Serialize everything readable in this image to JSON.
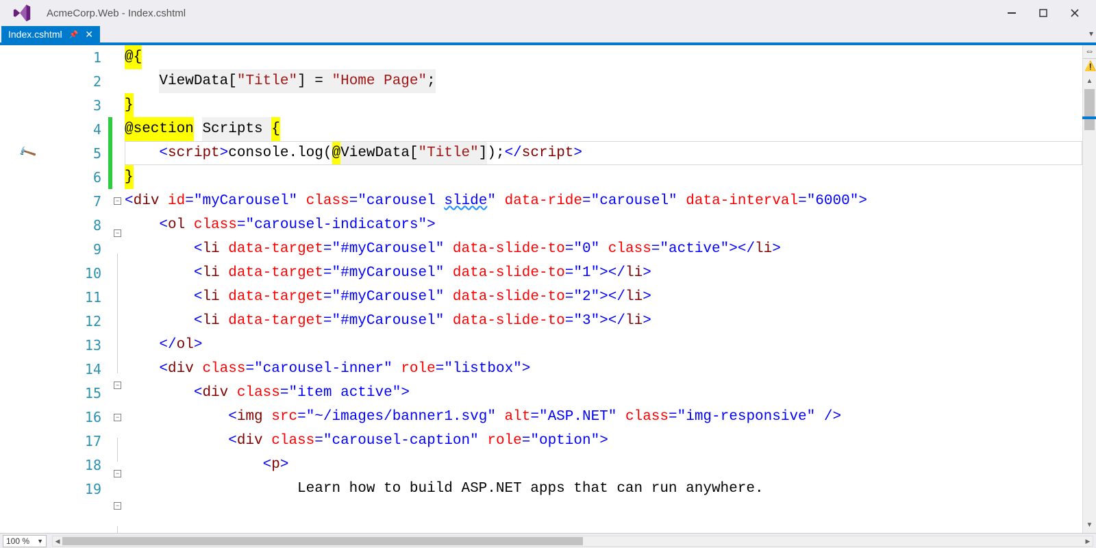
{
  "window": {
    "title": "AcmeCorp.Web - Index.cshtml"
  },
  "tab": {
    "filename": "Index.cshtml"
  },
  "zoom": "100 %",
  "code": {
    "lines": [
      {
        "n": 1,
        "tokens": [
          {
            "t": "@{",
            "c": "t-razor"
          }
        ]
      },
      {
        "n": 2,
        "tokens": [
          {
            "t": "    ",
            "c": ""
          },
          {
            "t": "ViewData[",
            "c": "t-plain t-razor-bg"
          },
          {
            "t": "\"Title\"",
            "c": "t-str t-razor-bg"
          },
          {
            "t": "] = ",
            "c": "t-plain t-razor-bg"
          },
          {
            "t": "\"Home Page\"",
            "c": "t-str t-razor-bg"
          },
          {
            "t": ";",
            "c": "t-plain t-razor-bg"
          }
        ]
      },
      {
        "n": 3,
        "tokens": [
          {
            "t": "}",
            "c": "t-razor"
          }
        ]
      },
      {
        "n": 4,
        "changed": true,
        "tokens": [
          {
            "t": "@section",
            "c": "t-razor"
          },
          {
            "t": " ",
            "c": ""
          },
          {
            "t": "Scripts ",
            "c": "t-plain t-razor-bg"
          },
          {
            "t": "{",
            "c": "t-razor"
          }
        ]
      },
      {
        "n": 5,
        "changed": true,
        "current": true,
        "glyph": "hammer",
        "tokens": [
          {
            "t": "    ",
            "c": ""
          },
          {
            "t": "<",
            "c": "t-punct"
          },
          {
            "t": "script",
            "c": "t-tag"
          },
          {
            "t": ">",
            "c": "t-punct"
          },
          {
            "t": "console.log(",
            "c": "t-plain"
          },
          {
            "t": "@",
            "c": "t-razor"
          },
          {
            "t": "ViewData[",
            "c": "t-plain t-razor-bg"
          },
          {
            "t": "\"Title\"",
            "c": "t-str t-razor-bg"
          },
          {
            "t": "]",
            "c": "t-plain t-razor-bg"
          },
          {
            "t": ");",
            "c": "t-plain"
          },
          {
            "t": "</",
            "c": "t-punct"
          },
          {
            "t": "script",
            "c": "t-tag"
          },
          {
            "t": ">",
            "c": "t-punct"
          }
        ]
      },
      {
        "n": 6,
        "changed": true,
        "tokens": [
          {
            "t": "}",
            "c": "t-razor"
          }
        ]
      },
      {
        "n": 7,
        "fold": "-",
        "tokens": [
          {
            "t": "<",
            "c": "t-punct"
          },
          {
            "t": "div ",
            "c": "t-tag"
          },
          {
            "t": "id",
            "c": "t-attr"
          },
          {
            "t": "=",
            "c": "t-punct"
          },
          {
            "t": "\"myCarousel\"",
            "c": "t-val"
          },
          {
            "t": " ",
            "c": ""
          },
          {
            "t": "class",
            "c": "t-attr"
          },
          {
            "t": "=",
            "c": "t-punct"
          },
          {
            "t": "\"carousel ",
            "c": "t-val"
          },
          {
            "t": "slide",
            "c": "t-val squiggle"
          },
          {
            "t": "\"",
            "c": "t-val"
          },
          {
            "t": " ",
            "c": ""
          },
          {
            "t": "data-ride",
            "c": "t-attr"
          },
          {
            "t": "=",
            "c": "t-punct"
          },
          {
            "t": "\"carousel\"",
            "c": "t-val"
          },
          {
            "t": " ",
            "c": ""
          },
          {
            "t": "data-interval",
            "c": "t-attr"
          },
          {
            "t": "=",
            "c": "t-punct"
          },
          {
            "t": "\"6000\"",
            "c": "t-val"
          },
          {
            "t": ">",
            "c": "t-punct"
          }
        ]
      },
      {
        "n": 8,
        "fold": "-",
        "tick": true,
        "tokens": [
          {
            "t": "    ",
            "c": ""
          },
          {
            "t": "<",
            "c": "t-punct"
          },
          {
            "t": "ol ",
            "c": "t-tag"
          },
          {
            "t": "class",
            "c": "t-attr"
          },
          {
            "t": "=",
            "c": "t-punct"
          },
          {
            "t": "\"carousel-indicators\"",
            "c": "t-val"
          },
          {
            "t": ">",
            "c": "t-punct"
          }
        ]
      },
      {
        "n": 9,
        "tick": true,
        "tokens": [
          {
            "t": "        ",
            "c": ""
          },
          {
            "t": "<",
            "c": "t-punct"
          },
          {
            "t": "li ",
            "c": "t-tag"
          },
          {
            "t": "data-target",
            "c": "t-attr"
          },
          {
            "t": "=",
            "c": "t-punct"
          },
          {
            "t": "\"#myCarousel\"",
            "c": "t-val"
          },
          {
            "t": " ",
            "c": ""
          },
          {
            "t": "data-slide-to",
            "c": "t-attr"
          },
          {
            "t": "=",
            "c": "t-punct"
          },
          {
            "t": "\"0\"",
            "c": "t-val"
          },
          {
            "t": " ",
            "c": ""
          },
          {
            "t": "class",
            "c": "t-attr"
          },
          {
            "t": "=",
            "c": "t-punct"
          },
          {
            "t": "\"active\"",
            "c": "t-val"
          },
          {
            "t": "></",
            "c": "t-punct"
          },
          {
            "t": "li",
            "c": "t-tag"
          },
          {
            "t": ">",
            "c": "t-punct"
          }
        ]
      },
      {
        "n": 10,
        "tick": true,
        "tokens": [
          {
            "t": "        ",
            "c": ""
          },
          {
            "t": "<",
            "c": "t-punct"
          },
          {
            "t": "li ",
            "c": "t-tag"
          },
          {
            "t": "data-target",
            "c": "t-attr"
          },
          {
            "t": "=",
            "c": "t-punct"
          },
          {
            "t": "\"#myCarousel\"",
            "c": "t-val"
          },
          {
            "t": " ",
            "c": ""
          },
          {
            "t": "data-slide-to",
            "c": "t-attr"
          },
          {
            "t": "=",
            "c": "t-punct"
          },
          {
            "t": "\"1\"",
            "c": "t-val"
          },
          {
            "t": "></",
            "c": "t-punct"
          },
          {
            "t": "li",
            "c": "t-tag"
          },
          {
            "t": ">",
            "c": "t-punct"
          }
        ]
      },
      {
        "n": 11,
        "tick": true,
        "tokens": [
          {
            "t": "        ",
            "c": ""
          },
          {
            "t": "<",
            "c": "t-punct"
          },
          {
            "t": "li ",
            "c": "t-tag"
          },
          {
            "t": "data-target",
            "c": "t-attr"
          },
          {
            "t": "=",
            "c": "t-punct"
          },
          {
            "t": "\"#myCarousel\"",
            "c": "t-val"
          },
          {
            "t": " ",
            "c": ""
          },
          {
            "t": "data-slide-to",
            "c": "t-attr"
          },
          {
            "t": "=",
            "c": "t-punct"
          },
          {
            "t": "\"2\"",
            "c": "t-val"
          },
          {
            "t": "></",
            "c": "t-punct"
          },
          {
            "t": "li",
            "c": "t-tag"
          },
          {
            "t": ">",
            "c": "t-punct"
          }
        ]
      },
      {
        "n": 12,
        "tick": true,
        "tokens": [
          {
            "t": "        ",
            "c": ""
          },
          {
            "t": "<",
            "c": "t-punct"
          },
          {
            "t": "li ",
            "c": "t-tag"
          },
          {
            "t": "data-target",
            "c": "t-attr"
          },
          {
            "t": "=",
            "c": "t-punct"
          },
          {
            "t": "\"#myCarousel\"",
            "c": "t-val"
          },
          {
            "t": " ",
            "c": ""
          },
          {
            "t": "data-slide-to",
            "c": "t-attr"
          },
          {
            "t": "=",
            "c": "t-punct"
          },
          {
            "t": "\"3\"",
            "c": "t-val"
          },
          {
            "t": "></",
            "c": "t-punct"
          },
          {
            "t": "li",
            "c": "t-tag"
          },
          {
            "t": ">",
            "c": "t-punct"
          }
        ]
      },
      {
        "n": 13,
        "tick": true,
        "tokens": [
          {
            "t": "    ",
            "c": ""
          },
          {
            "t": "</",
            "c": "t-punct"
          },
          {
            "t": "ol",
            "c": "t-tag"
          },
          {
            "t": ">",
            "c": "t-punct"
          }
        ]
      },
      {
        "n": 14,
        "fold": "-",
        "tick": true,
        "tokens": [
          {
            "t": "    ",
            "c": ""
          },
          {
            "t": "<",
            "c": "t-punct"
          },
          {
            "t": "div ",
            "c": "t-tag"
          },
          {
            "t": "class",
            "c": "t-attr"
          },
          {
            "t": "=",
            "c": "t-punct"
          },
          {
            "t": "\"carousel-inner\"",
            "c": "t-val"
          },
          {
            "t": " ",
            "c": ""
          },
          {
            "t": "role",
            "c": "t-attr"
          },
          {
            "t": "=",
            "c": "t-punct"
          },
          {
            "t": "\"listbox\"",
            "c": "t-val"
          },
          {
            "t": ">",
            "c": "t-punct"
          }
        ]
      },
      {
        "n": 15,
        "fold": "-",
        "tick": true,
        "tokens": [
          {
            "t": "        ",
            "c": ""
          },
          {
            "t": "<",
            "c": "t-punct"
          },
          {
            "t": "div ",
            "c": "t-tag"
          },
          {
            "t": "class",
            "c": "t-attr"
          },
          {
            "t": "=",
            "c": "t-punct"
          },
          {
            "t": "\"item active\"",
            "c": "t-val"
          },
          {
            "t": ">",
            "c": "t-punct"
          }
        ]
      },
      {
        "n": 16,
        "tick": true,
        "tokens": [
          {
            "t": "            ",
            "c": ""
          },
          {
            "t": "<",
            "c": "t-punct"
          },
          {
            "t": "img ",
            "c": "t-tag"
          },
          {
            "t": "src",
            "c": "t-attr"
          },
          {
            "t": "=",
            "c": "t-punct"
          },
          {
            "t": "\"~/images/banner1.svg\"",
            "c": "t-val"
          },
          {
            "t": " ",
            "c": ""
          },
          {
            "t": "alt",
            "c": "t-attr"
          },
          {
            "t": "=",
            "c": "t-punct"
          },
          {
            "t": "\"ASP.NET\"",
            "c": "t-val"
          },
          {
            "t": " ",
            "c": ""
          },
          {
            "t": "class",
            "c": "t-attr"
          },
          {
            "t": "=",
            "c": "t-punct"
          },
          {
            "t": "\"img-responsive\"",
            "c": "t-val"
          },
          {
            "t": " />",
            "c": "t-punct"
          }
        ]
      },
      {
        "n": 17,
        "fold": "-",
        "tick": true,
        "tokens": [
          {
            "t": "            ",
            "c": ""
          },
          {
            "t": "<",
            "c": "t-punct"
          },
          {
            "t": "div ",
            "c": "t-tag"
          },
          {
            "t": "class",
            "c": "t-attr"
          },
          {
            "t": "=",
            "c": "t-punct"
          },
          {
            "t": "\"carousel-caption\"",
            "c": "t-val"
          },
          {
            "t": " ",
            "c": ""
          },
          {
            "t": "role",
            "c": "t-attr"
          },
          {
            "t": "=",
            "c": "t-punct"
          },
          {
            "t": "\"option\"",
            "c": "t-val"
          },
          {
            "t": ">",
            "c": "t-punct"
          }
        ]
      },
      {
        "n": 18,
        "fold": "-",
        "tick": true,
        "tokens": [
          {
            "t": "                ",
            "c": ""
          },
          {
            "t": "<",
            "c": "t-punct"
          },
          {
            "t": "p",
            "c": "t-tag"
          },
          {
            "t": ">",
            "c": "t-punct"
          }
        ]
      },
      {
        "n": 19,
        "tick": true,
        "tokens": [
          {
            "t": "                    Learn how to build ASP.NET apps that can run anywhere.",
            "c": "t-plain"
          }
        ]
      }
    ]
  }
}
